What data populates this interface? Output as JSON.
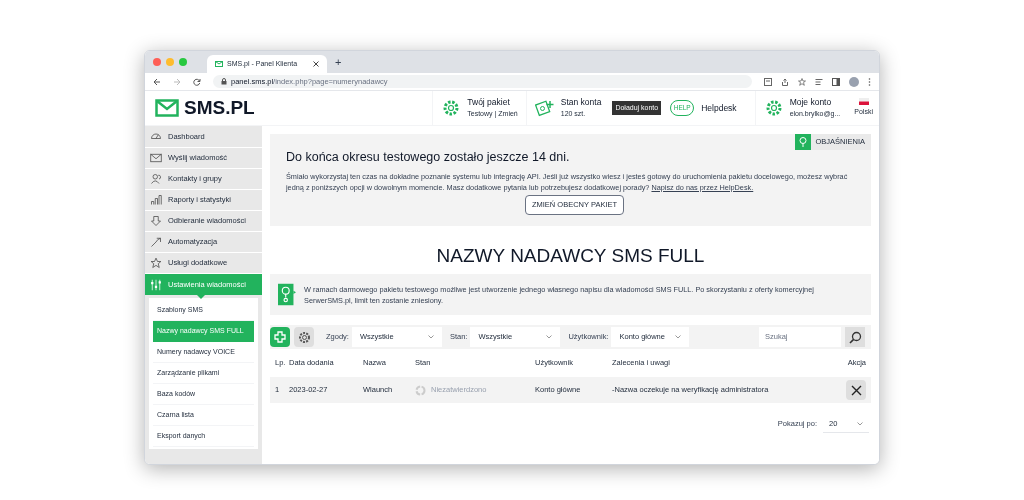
{
  "browser": {
    "tab_title": "SMS.pl - Panel Klienta",
    "new_tab": "+",
    "address_host": "panel.sms.pl",
    "address_path": "/index.php?page=numerynadawcy"
  },
  "header": {
    "logo": "SMS.PL",
    "items": [
      {
        "kind": "package",
        "title": "Twój pakiet",
        "subtitle": "Testowy | Zmień"
      },
      {
        "kind": "balance",
        "title": "Stan konta",
        "subtitle": "120 szt."
      },
      {
        "kind": "topup",
        "title": "Doładuj konto"
      },
      {
        "kind": "helpdesk",
        "title": "Helpdesk",
        "badge": "HELP"
      },
      {
        "kind": "account",
        "title": "Moje konto",
        "subtitle": "elon.brylko@g..."
      },
      {
        "kind": "language",
        "title": "Polski"
      }
    ]
  },
  "sidebar": {
    "items": [
      {
        "label": "Dashboard",
        "selected": false
      },
      {
        "label": "Wyślij wiadomość",
        "selected": false
      },
      {
        "label": "Kontakty i grupy",
        "selected": false
      },
      {
        "label": "Raporty i statystyki",
        "selected": false
      },
      {
        "label": "Odbieranie wiadomości",
        "selected": false
      },
      {
        "label": "Automatyzacja",
        "selected": false
      },
      {
        "label": "Usługi dodatkowe",
        "selected": false
      },
      {
        "label": "Ustawienia wiadomości",
        "selected": true,
        "children": [
          {
            "label": "Szablony SMS",
            "selected": false
          },
          {
            "label": "Nazwy nadawcy SMS FULL",
            "selected": true
          },
          {
            "label": "Numery nadawcy VOICE",
            "selected": false
          },
          {
            "label": "Zarządzanie plikami",
            "selected": false
          },
          {
            "label": "Baza kodów",
            "selected": false
          },
          {
            "label": "Czarna lista",
            "selected": false
          },
          {
            "label": "Eksport danych",
            "selected": false
          }
        ]
      }
    ]
  },
  "trial_banner": {
    "help_button": "OBJAŚNIENIA",
    "title": "Do końca okresu testowego zostało jeszcze 14 dni.",
    "text": "Śmiało wykorzystaj ten czas na dokładne poznanie systemu lub integrację API. Jeśli już wszystko wiesz i jesteś gotowy do uruchomienia pakietu docelowego, możesz wybrać jedną z poniższych opcji w dowolnym momencie. Masz dodatkowe pytania lub potrzebujesz dodatkowej porady?",
    "link": "Napisz do nas przez HelpDesk.",
    "button": "ZMIEŃ OBECNY PAKIET"
  },
  "page_title": "NAZWY NADAWCY SMS FULL",
  "notice": "W ramach darmowego pakietu testowego możliwe jest utworzenie jednego własnego napisu dla wiadomości SMS FULL. Po skorzystaniu z oferty komercyjnej SerwerSMS.pl, limit ten zostanie zniesiony.",
  "filters": [
    {
      "label": "Zgody:",
      "value": "Wszystkie"
    },
    {
      "label": "Stan:",
      "value": "Wszystkie"
    },
    {
      "label": "Użytkownik:",
      "value": "Konto główne"
    }
  ],
  "search": {
    "placeholder": "Szukaj"
  },
  "table": {
    "columns": [
      "Lp.",
      "Data dodania",
      "Nazwa",
      "Stan",
      "Użytkownik",
      "Zalecenia i uwagi",
      "Akcja"
    ],
    "rows": [
      {
        "cells": [
          "1",
          "2023-02-27",
          "Wlaunch",
          "Niezatwierdzono",
          "Konto główne",
          "-Nazwa oczekuje na weryfikację administratora"
        ],
        "approved": false
      }
    ]
  },
  "pagination": {
    "label": "Pokazuj po:",
    "value": "20"
  }
}
